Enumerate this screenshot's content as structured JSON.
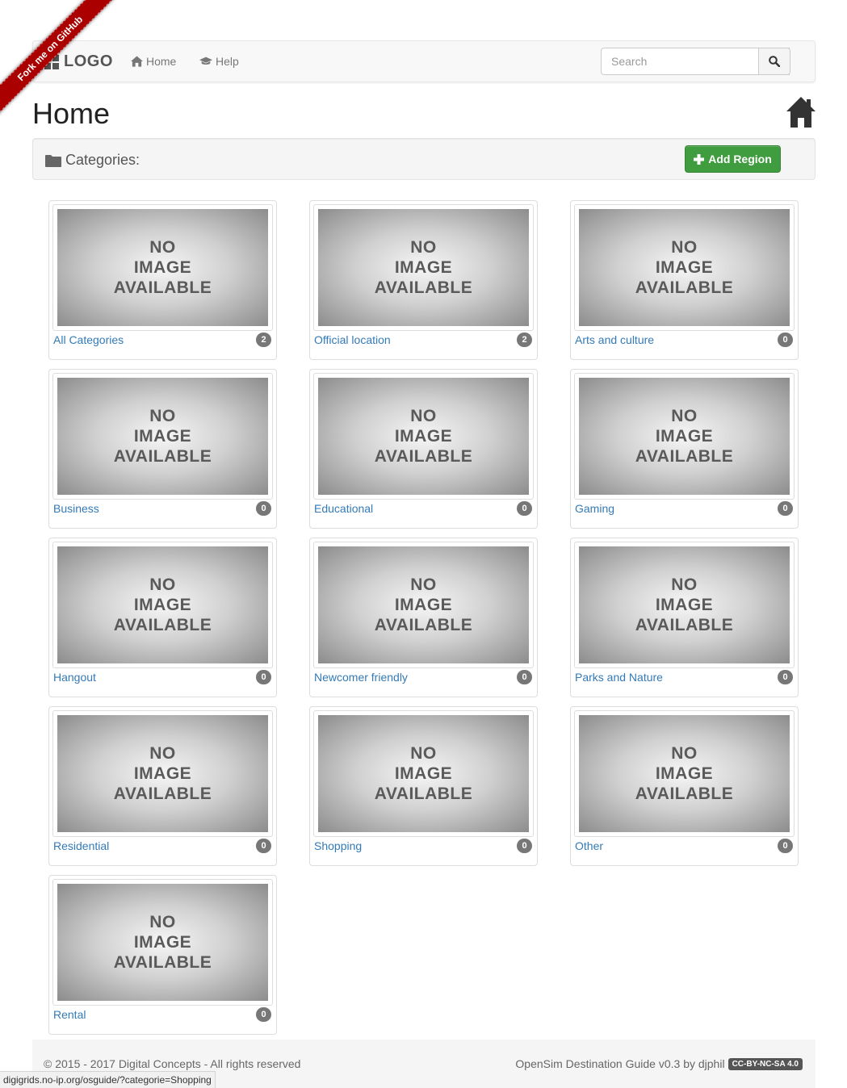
{
  "ribbon": {
    "label": "Fork me on GitHub"
  },
  "navbar": {
    "brand": "LOGO",
    "links": [
      {
        "label": "Home",
        "icon": "home-icon"
      },
      {
        "label": "Help",
        "icon": "graduation-cap-icon"
      }
    ],
    "search": {
      "placeholder": "Search",
      "value": ""
    }
  },
  "page": {
    "title": "Home"
  },
  "categories_bar": {
    "label": "Categories:",
    "add_button": "Add Region"
  },
  "no_image": [
    "NO",
    "IMAGE",
    "AVAILABLE"
  ],
  "categories": [
    {
      "name": "All Categories",
      "count": "2"
    },
    {
      "name": "Official location",
      "count": "2"
    },
    {
      "name": "Arts and culture",
      "count": "0"
    },
    {
      "name": "Business",
      "count": "0"
    },
    {
      "name": "Educational",
      "count": "0"
    },
    {
      "name": "Gaming",
      "count": "0"
    },
    {
      "name": "Hangout",
      "count": "0"
    },
    {
      "name": "Newcomer friendly",
      "count": "0"
    },
    {
      "name": "Parks and Nature",
      "count": "0"
    },
    {
      "name": "Residential",
      "count": "0"
    },
    {
      "name": "Shopping",
      "count": "0"
    },
    {
      "name": "Other",
      "count": "0"
    },
    {
      "name": "Rental",
      "count": "0"
    }
  ],
  "footer": {
    "copyright": "© 2015 - 2017 Digital Concepts - All rights reserved",
    "credit": "OpenSim Destination Guide v0.3 by djphil",
    "license": "CC-BY-NC-SA 4.0"
  },
  "status_bar": {
    "url": "digigrids.no-ip.org/osguide/?categorie=Shopping"
  },
  "colors": {
    "link": "#337ab7",
    "add_button": "#3f9c3f",
    "ribbon": "#aa0000",
    "badge": "#777777"
  }
}
